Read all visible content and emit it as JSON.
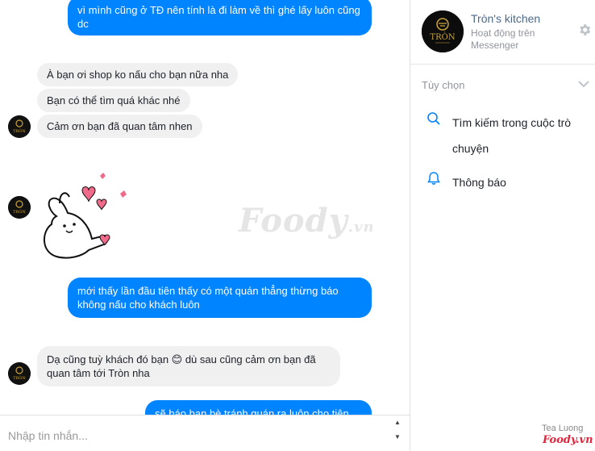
{
  "conversation": {
    "messages": [
      {
        "from": "me",
        "text": "vì mình cũng ở TĐ nên tính là đi làm về thì ghé lấy luôn cũng dc"
      },
      {
        "from": "page",
        "text": "À bạn ơi shop ko nấu cho bạn nữa nha"
      },
      {
        "from": "page",
        "text": "Bạn có thể tìm quá khác nhé"
      },
      {
        "from": "page",
        "text": "Cảm ơn bạn đã quan tâm nhen"
      },
      {
        "from": "page",
        "type": "sticker",
        "icon": "bunny-hearts-sticker"
      },
      {
        "from": "me",
        "text": "mới thấy lần đầu tiên thấy có một quán thẳng thừng báo không nấu cho khách luôn"
      },
      {
        "from": "page",
        "text": "Dạ cũng tuỳ khách đó bạn 😊 dù sau cũng cảm ơn bạn đã quan tâm tới Tròn nha"
      },
      {
        "from": "me",
        "text": "sẽ báo bạn bè tránh quán ra luôn cho tiện"
      }
    ]
  },
  "watermark": {
    "brand": "Foody",
    "suffix": ".vn"
  },
  "composer": {
    "placeholder": "Nhập tin nhắn..."
  },
  "sidebar": {
    "page_name": "Tròn's kitchen",
    "status": "Hoạt động trên Messenger",
    "avatar_text": "TRÒN",
    "options_title": "Tùy chọn",
    "options": [
      {
        "label": "Tìm kiếm trong cuộc trò chuyện",
        "icon": "search-icon"
      },
      {
        "label": "Thông báo",
        "icon": "bell-icon"
      }
    ]
  },
  "credit": {
    "author": "Tea Luong",
    "site": "Foody.vn"
  },
  "colors": {
    "accent": "#0084ff",
    "incoming": "#f1f0f0",
    "link": "#4b6a8a"
  }
}
